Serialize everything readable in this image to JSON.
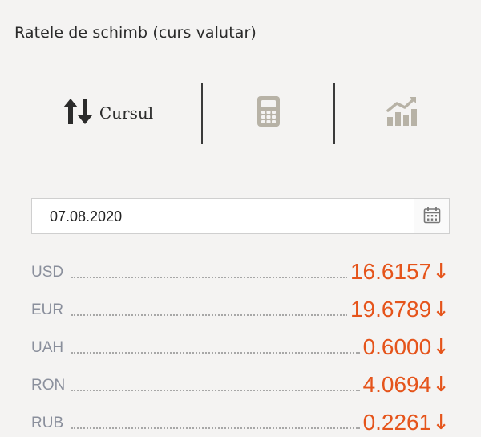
{
  "title": "Ratele de schimb (curs valutar)",
  "tabs": [
    {
      "label": "Cursul",
      "icon": "up-down-arrows-icon",
      "active": true
    },
    {
      "label": "",
      "icon": "calculator-icon",
      "active": false
    },
    {
      "label": "",
      "icon": "bar-chart-icon",
      "active": false
    }
  ],
  "date": {
    "value": "07.08.2020",
    "icon": "calendar-icon"
  },
  "rates": [
    {
      "code": "USD",
      "value": "16.6157",
      "trend": "↓"
    },
    {
      "code": "EUR",
      "value": "19.6789",
      "trend": "↓"
    },
    {
      "code": "UAH",
      "value": "0.6000",
      "trend": "↓"
    },
    {
      "code": "RON",
      "value": "4.0694",
      "trend": "↓"
    },
    {
      "code": "RUB",
      "value": "0.2261",
      "trend": "↓"
    }
  ],
  "colors": {
    "background": "#f4f3f2",
    "accent": "#e5541b",
    "code_text": "#8a8f9c",
    "icon_muted": "#b7b2a6"
  }
}
